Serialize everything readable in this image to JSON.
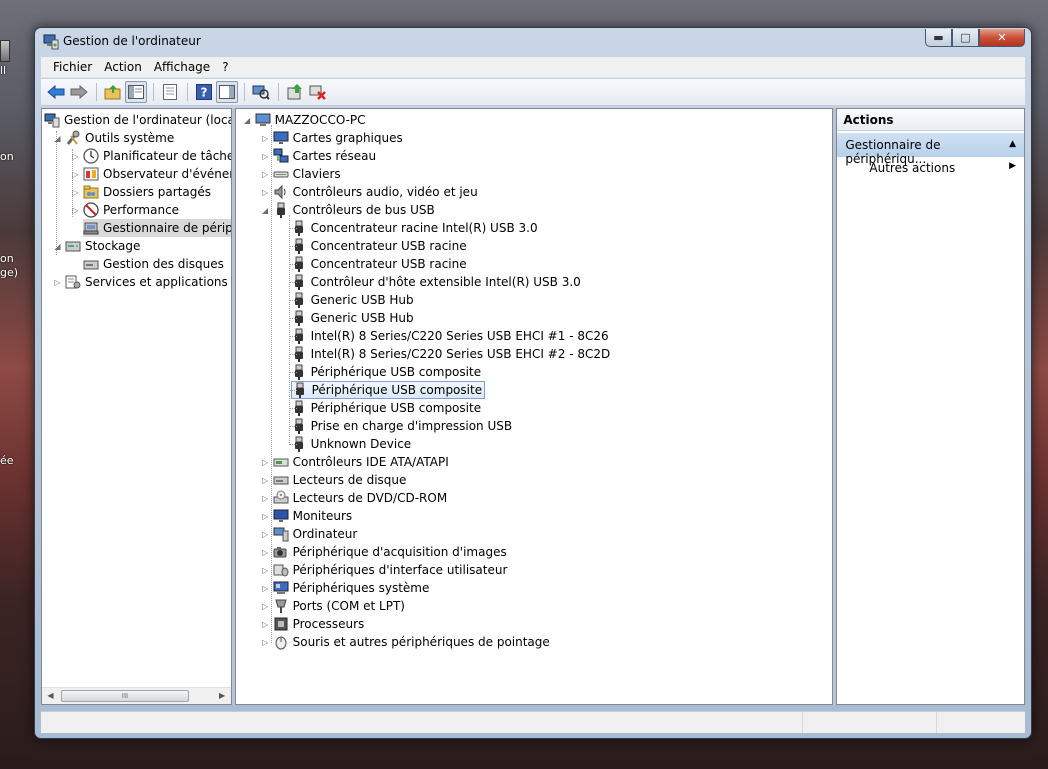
{
  "desktop": {
    "fragments": [
      "ll",
      "on",
      "on",
      "ge)",
      "ée"
    ]
  },
  "window": {
    "title": "Gestion de l'ordinateur",
    "minimize": "▬",
    "maximize": "□",
    "close": "✕"
  },
  "menu": [
    "Fichier",
    "Action",
    "Affichage",
    "?"
  ],
  "toolbar": {
    "buttons": [
      "back-arrow-icon",
      "forward-arrow-icon",
      "folder-up-icon",
      "console-tree-icon",
      "properties-icon",
      "help-icon",
      "show-pane-icon",
      "scan-hardware-icon",
      "update-driver-icon",
      "uninstall-icon"
    ]
  },
  "left_tree": {
    "root": "Gestion de l'ordinateur (local)",
    "items": [
      {
        "label": "Outils système"
      },
      {
        "label": "Planificateur de tâches"
      },
      {
        "label": "Observateur d'événeme"
      },
      {
        "label": "Dossiers partagés"
      },
      {
        "label": "Performance"
      },
      {
        "label": "Gestionnaire de périphé"
      },
      {
        "label": "Stockage"
      },
      {
        "label": "Gestion des disques"
      },
      {
        "label": "Services et applications"
      }
    ],
    "scroll_thumb": "III"
  },
  "device_tree": {
    "computer": "MAZZOCCO-PC",
    "categories_before": [
      "Cartes graphiques",
      "Cartes réseau",
      "Claviers",
      "Contrôleurs audio, vidéo et jeu"
    ],
    "usb_category": "Contrôleurs de bus USB",
    "usb_devices": [
      "Concentrateur racine Intel(R) USB 3.0",
      "Concentrateur USB racine",
      "Concentrateur USB racine",
      "Contrôleur d'hôte extensible Intel(R) USB 3.0",
      "Generic USB Hub",
      "Generic USB Hub",
      "Intel(R) 8 Series/C220 Series USB EHCI #1 - 8C26",
      "Intel(R) 8 Series/C220 Series USB EHCI #2 - 8C2D",
      "Périphérique USB composite",
      "Périphérique USB composite",
      "Périphérique USB composite",
      "Prise en charge d'impression USB",
      "Unknown Device"
    ],
    "selected_usb_index": 9,
    "categories_after": [
      "Contrôleurs IDE ATA/ATAPI",
      "Lecteurs de disque",
      "Lecteurs de DVD/CD-ROM",
      "Moniteurs",
      "Ordinateur",
      "Périphérique d'acquisition d'images",
      "Périphériques d'interface utilisateur",
      "Périphériques système",
      "Ports (COM et LPT)",
      "Processeurs",
      "Souris et autres périphériques de pointage"
    ]
  },
  "actions": {
    "header": "Actions",
    "section": "Gestionnaire de périphériqu...",
    "item": "Autres actions"
  },
  "colors": {
    "selection_blue": "#dce9f8",
    "selection_border": "#7da2ce",
    "actions_section": "#c4d8ee"
  }
}
